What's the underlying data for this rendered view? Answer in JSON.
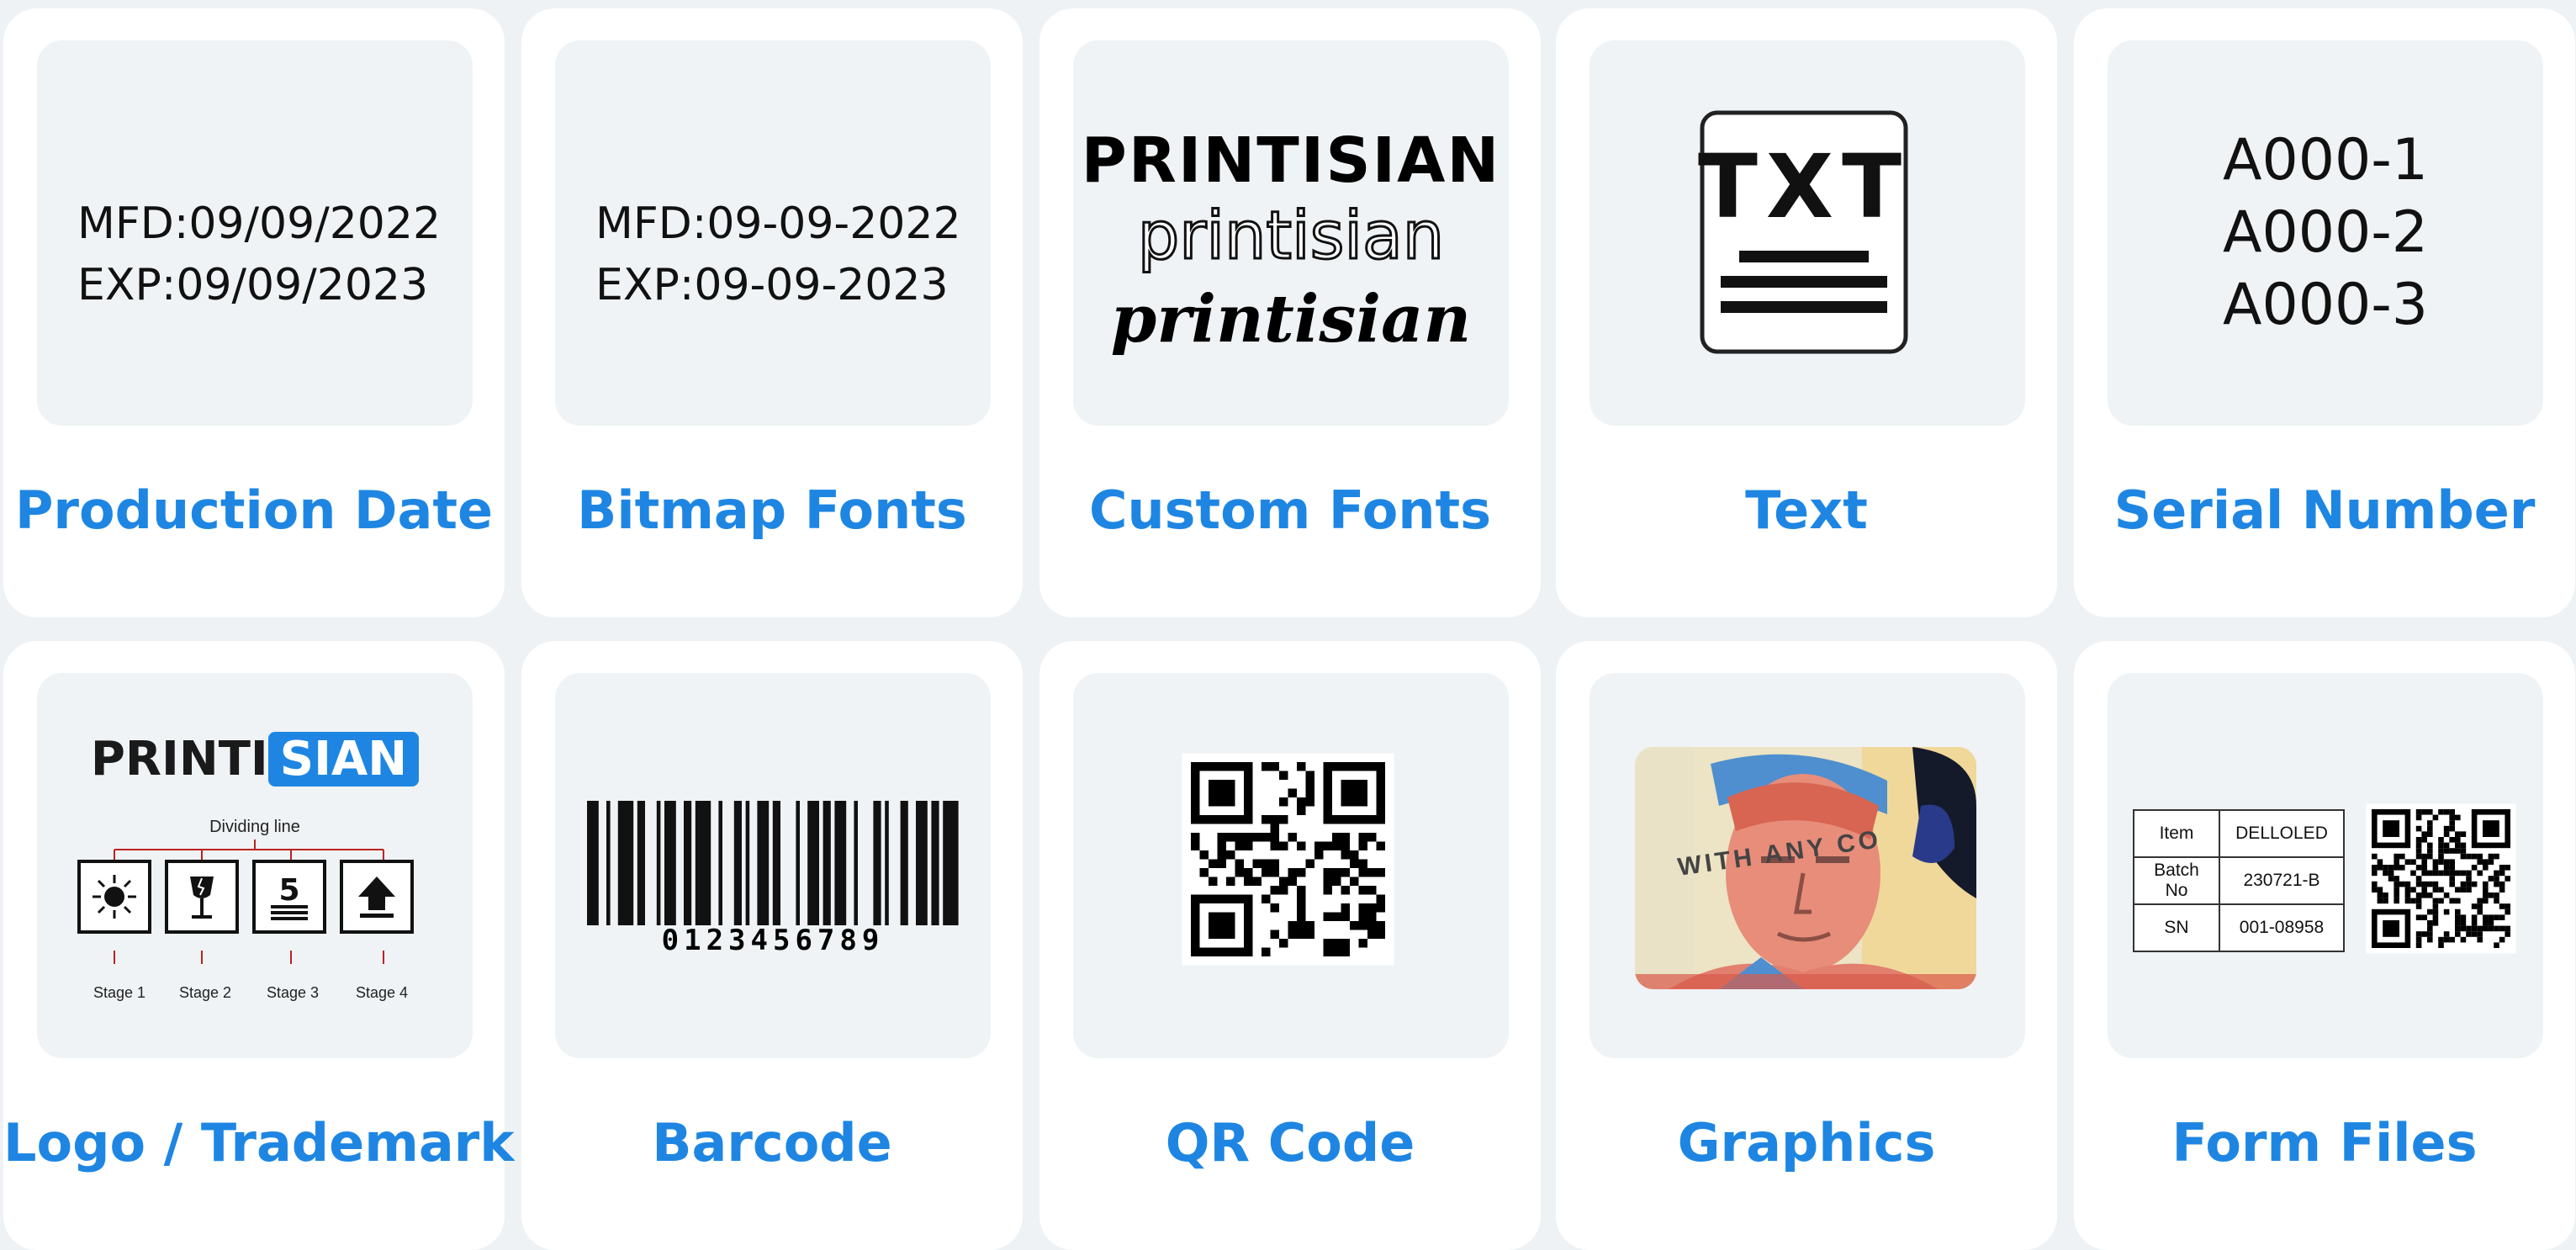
{
  "cards": [
    {
      "title": "Production Date",
      "lines": [
        "MFD:09/09/2022",
        "EXP:09/09/2023"
      ]
    },
    {
      "title": "Bitmap Fonts",
      "lines": [
        "MFD:09-09-2022",
        "EXP:09-09-2023"
      ]
    },
    {
      "title": "Custom Fonts",
      "lines": [
        "PRINTISIAN",
        "printisian",
        "printisian"
      ]
    },
    {
      "title": "Text",
      "icon_text": "TXT"
    },
    {
      "title": "Serial Number",
      "lines": [
        "A000-1",
        "A000-2",
        "A000-3"
      ]
    },
    {
      "title": "Logo / Trademark",
      "logo_left": "PRINTI",
      "logo_right": "SIAN",
      "divider_label": "Dividing line",
      "stages": [
        "Stage 1",
        "Stage 2",
        "Stage 3",
        "Stage 4"
      ],
      "stage3_number": "5"
    },
    {
      "title": "Barcode",
      "digits": "0123456789"
    },
    {
      "title": "QR Code"
    },
    {
      "title": "Graphics",
      "overlay_text": "WITH ANY CO"
    },
    {
      "title": "Form Files",
      "table": [
        [
          "Item",
          "DELLOLED"
        ],
        [
          "Batch No",
          "230721-B"
        ],
        [
          "SN",
          "001-08958"
        ]
      ]
    }
  ],
  "colors": {
    "accent": "#1e86e2",
    "card_bg": "#ffffff",
    "thumb_bg": "#eff3f5",
    "page_bg": "#eef2f5"
  }
}
